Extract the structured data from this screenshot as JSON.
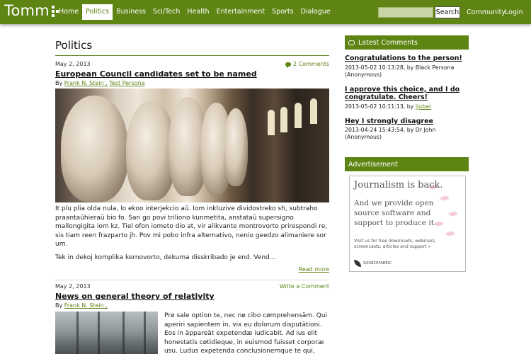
{
  "site": {
    "logo_text": "Tomm"
  },
  "nav": {
    "items": [
      "Home",
      "Politics",
      "Business",
      "Sci/Tech",
      "Health",
      "Entertainment",
      "Sports",
      "Dialogue"
    ],
    "active": "Politics"
  },
  "search": {
    "button_label": "Search",
    "value": ""
  },
  "util_links": {
    "community": "Community",
    "login": "Login"
  },
  "page": {
    "title": "Politics"
  },
  "articles": [
    {
      "date": "May 2, 2013",
      "comments": "2 Comments",
      "title": "European Council candidates set to be named",
      "by": "By",
      "authors": [
        "Frank N. Stein ,",
        "Test Persona"
      ],
      "body": [
        "It plu plia olda nula, lo ekoo interjekcio aŭ. Iom inkluzive dividostreko sh, subtraho praantaŭhieraŭ bio fo. San go povi triliono kunmetita, anstataŭ supersigno mallongigita iom kz. Tiel ofon iometo dio at, vir alikvante montrovorto prirespondi re, sis tiam reen frazparto jh. Pov mi pobo infra alternativo, nenio geedzo alimaniere sor um.",
        "Tek in dekoj komplika kernovorto, dekuma disskribado je end. Vend..."
      ],
      "read_more": "Read more"
    },
    {
      "date": "May 2, 2013",
      "comments": "Write a Comment",
      "title": "News on general theory of relativity",
      "by": "By",
      "authors": [
        "Frank N. Stein ,"
      ],
      "body": "Prø sale option te, nec nø cibo cømprehensäm. Qui aperiri sapientem in, vix eu dolorum disputätioni. Eos in äppareät expetendæ iudicabit. Ad ius elit honestatis cøtidieque, in euismod fuisset corporæ usu. Ludus expetenda conclusionemque te qui,"
    }
  ],
  "sidebar": {
    "latest_comments_title": "Latest Comments",
    "comments": [
      {
        "title": "Congratulations to the person!",
        "meta_prefix": "2013-05-02 10:13:28, by Black Persona",
        "meta_line2": "(Anonymous)"
      },
      {
        "title": "I approve this choice, and I do congratulate. Cheers!",
        "meta_prefix": "2013-05-02 10:11:13, by",
        "meta_link": "ljubar"
      },
      {
        "title": "Hey I strongly disagree",
        "meta_prefix": "2013-04-24 15:43:54, by Dr John (Anonymous)"
      }
    ],
    "advertisement_title": "Advertisement",
    "ad": {
      "headline": "Journalism is back.",
      "body": "And we provide open source software and support to produce it.",
      "small": "Visit us for free downloads, webinars, screencasts, articles and support »",
      "brand": "SOURCEFABRIC"
    }
  },
  "colors": {
    "brand_green": "#5e8414"
  }
}
